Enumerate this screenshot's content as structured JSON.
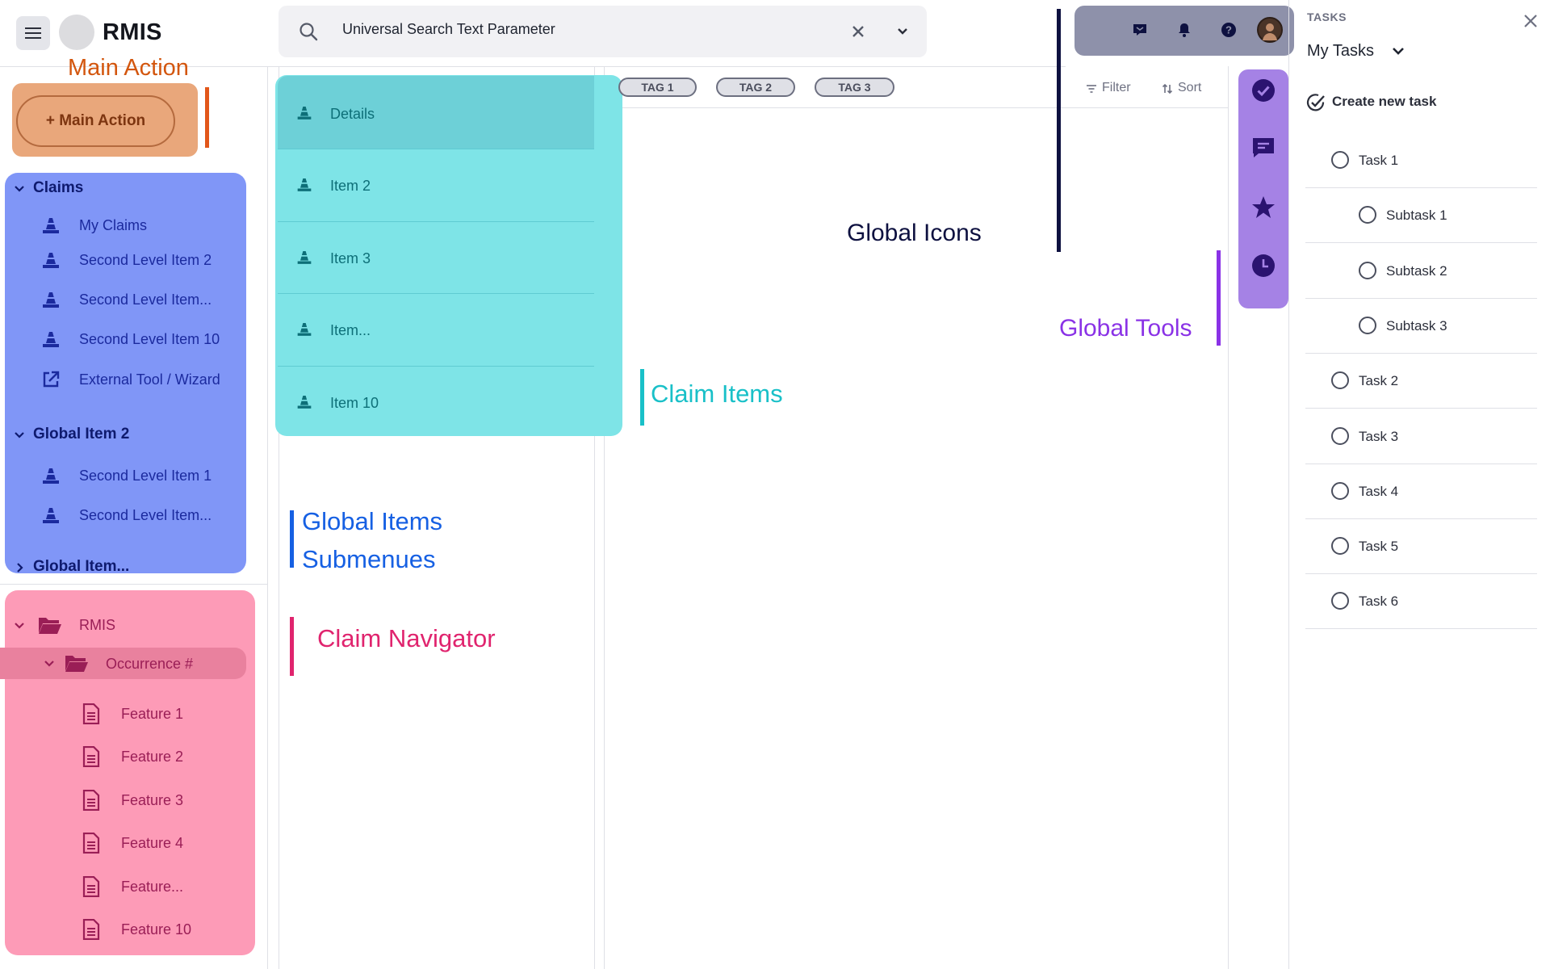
{
  "app": {
    "title": "RMIS"
  },
  "search": {
    "text": "Universal Search Text Parameter"
  },
  "main_action": {
    "caption": "Main Action",
    "button_label": "+ Main Action",
    "caption_color": "#d3560e",
    "area_color": "#e9a77b"
  },
  "nav": {
    "groups": [
      {
        "label": "Claims",
        "expanded": true,
        "items": [
          {
            "label": "My Claims",
            "icon": "cone-icon"
          },
          {
            "label": "Second Level Item 2",
            "icon": "cone-icon"
          },
          {
            "label": "Second Level Item...",
            "icon": "cone-icon"
          },
          {
            "label": "Second Level Item 10",
            "icon": "cone-icon"
          },
          {
            "label": "External Tool / Wizard",
            "icon": "external-link-icon"
          }
        ]
      },
      {
        "label": "Global Item 2",
        "expanded": true,
        "items": [
          {
            "label": "Second Level Item 1",
            "icon": "cone-icon"
          },
          {
            "label": "Second Level Item...",
            "icon": "cone-icon"
          }
        ]
      },
      {
        "label": "Global Item...",
        "expanded": false,
        "items": []
      }
    ],
    "panel_color": "#8096f7"
  },
  "claim_navigator": {
    "root": "RMIS",
    "occurrence": "Occurrence #",
    "features": [
      "Feature 1",
      "Feature 2",
      "Feature 3",
      "Feature 4",
      "Feature...",
      "Feature 10"
    ],
    "panel_color": "#fd9bb7"
  },
  "claim_items": {
    "items": [
      "Details",
      "Item 2",
      "Item 3",
      "Item...",
      "Item 10"
    ],
    "panel_color": "#7ee4e7"
  },
  "tags": [
    "TAG 1",
    "TAG 2",
    "TAG 3"
  ],
  "toolbar": {
    "filter": "Filter",
    "sort": "Sort"
  },
  "annotations": {
    "main_action": "Main Action",
    "global_icons": "Global Icons",
    "global_tools": "Global Tools",
    "claim_items": "Claim Items",
    "global_items_line1": "Global Items",
    "global_items_line2": "Submenues",
    "claim_navigator": "Claim Navigator"
  },
  "global_icons": {
    "icons": [
      "message-icon",
      "bell-icon",
      "help-icon",
      "avatar"
    ],
    "color": "#8e91aa"
  },
  "global_tools": {
    "icons": [
      "check-circle-icon",
      "comment-icon",
      "star-icon",
      "clock-icon"
    ],
    "color": "#a582e5"
  },
  "tasks": {
    "heading": "TASKS",
    "selector": "My Tasks",
    "create": "Create new task",
    "items": [
      {
        "label": "Task 1",
        "level": 0
      },
      {
        "label": "Subtask 1",
        "level": 1
      },
      {
        "label": "Subtask 2",
        "level": 1
      },
      {
        "label": "Subtask 3",
        "level": 1
      },
      {
        "label": "Task 2",
        "level": 0
      },
      {
        "label": "Task 3",
        "level": 0
      },
      {
        "label": "Task 4",
        "level": 0
      },
      {
        "label": "Task 5",
        "level": 0
      },
      {
        "label": "Task 6",
        "level": 0
      }
    ]
  }
}
